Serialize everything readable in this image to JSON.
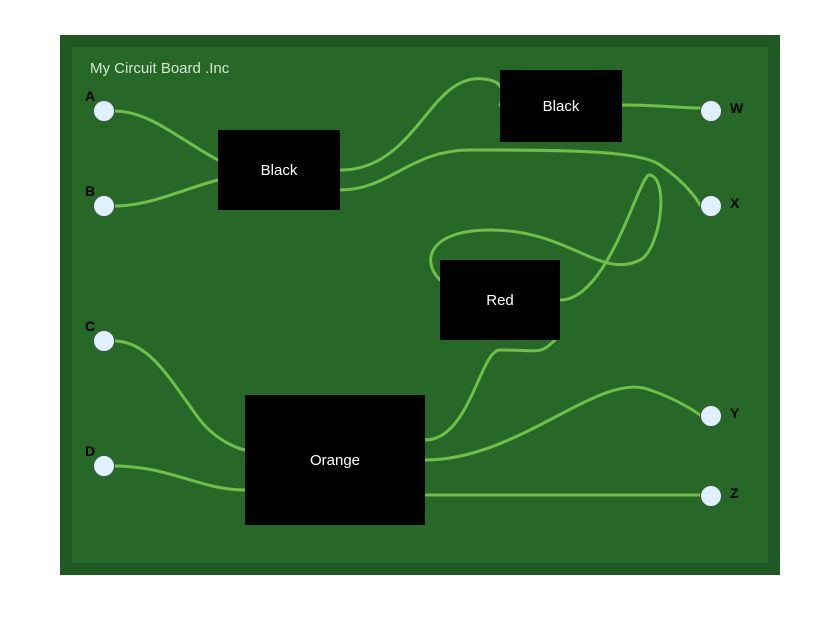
{
  "board": {
    "title": "My Circuit Board .Inc",
    "chips": {
      "black1": "Black",
      "black2": "Black",
      "red": "Red",
      "orange": "Orange"
    },
    "pins": {
      "left": {
        "A": "A",
        "B": "B",
        "C": "C",
        "D": "D"
      },
      "right": {
        "W": "W",
        "X": "X",
        "Y": "Y",
        "Z": "Z"
      }
    },
    "colors": {
      "board_outer": "#1f5822",
      "board_inner": "#276828",
      "trace": "#6fbf4a",
      "chip_bg": "#000000",
      "pin_fill": "#e0f0ff"
    }
  }
}
